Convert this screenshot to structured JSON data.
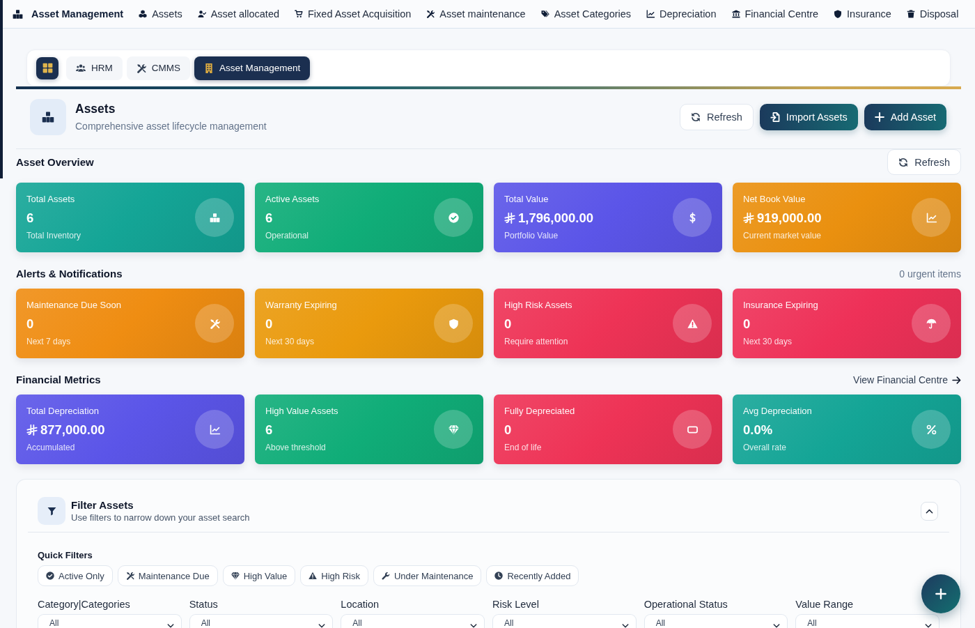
{
  "top_nav": {
    "brand": "Asset Management",
    "items": [
      "Assets",
      "Asset allocated",
      "Fixed Asset Acquisition",
      "Asset maintenance",
      "Asset Categories",
      "Depreciation",
      "Financial Centre",
      "Insurance",
      "Disposal"
    ]
  },
  "module_tabs": [
    {
      "label": "HRM",
      "selected": false
    },
    {
      "label": "CMMS",
      "selected": false
    },
    {
      "label": "Asset Management",
      "selected": true
    }
  ],
  "page_header": {
    "title": "Assets",
    "subtitle": "Comprehensive asset lifecycle management",
    "buttons": [
      {
        "label": "Refresh",
        "kind": "outline"
      },
      {
        "label": "Import Assets",
        "kind": "primary"
      },
      {
        "label": "Add Asset",
        "kind": "primary"
      }
    ]
  },
  "sections": [
    {
      "title": "Asset Overview",
      "aside": {
        "kind": "button",
        "label": "Refresh"
      },
      "cards": [
        {
          "label": "Total Assets",
          "value": "6",
          "note": "Total Inventory",
          "currency": false,
          "color": "#14a596"
        },
        {
          "label": "Active Assets",
          "value": "6",
          "note": "Operational",
          "currency": false,
          "color": "#10ad78"
        },
        {
          "label": "Total Value",
          "value": "1,796,000.00",
          "note": "Portfolio Value",
          "currency": true,
          "color": "#5b55e8"
        },
        {
          "label": "Net Book Value",
          "value": "919,000.00",
          "note": "Current market value",
          "currency": true,
          "color": "#ea900f"
        }
      ]
    },
    {
      "title": "Alerts & Notifications",
      "aside": {
        "kind": "note",
        "label": "0 urgent items"
      },
      "cards": [
        {
          "label": "Maintenance Due Soon",
          "value": "0",
          "note": "Next 7 days",
          "currency": false,
          "color": "#ef8d12"
        },
        {
          "label": "Warranty Expiring",
          "value": "0",
          "note": "Next 30 days",
          "currency": false,
          "color": "#ea9a0d"
        },
        {
          "label": "High Risk Assets",
          "value": "0",
          "note": "Require attention",
          "currency": false,
          "color": "#ee3356"
        },
        {
          "label": "Insurance Expiring",
          "value": "0",
          "note": "Next 30 days",
          "currency": false,
          "color": "#ee3158"
        }
      ]
    },
    {
      "title": "Financial Metrics",
      "aside": {
        "kind": "link",
        "label": "View Financial Centre"
      },
      "cards": [
        {
          "label": "Total Depreciation",
          "value": "877,000.00",
          "note": "Accumulated",
          "currency": true,
          "color": "#5b55e8"
        },
        {
          "label": "High Value Assets",
          "value": "6",
          "note": "Above threshold",
          "currency": false,
          "color": "#10ad78"
        },
        {
          "label": "Fully Depreciated",
          "value": "0",
          "note": "End of life",
          "currency": false,
          "color": "#ee3356"
        },
        {
          "label": "Avg Depreciation",
          "value": "0.0%",
          "note": "Overall rate",
          "currency": false,
          "color": "#14a596"
        }
      ]
    }
  ],
  "filters": {
    "title": "Filter Assets",
    "subtitle": "Use filters to narrow down your asset search",
    "expanded": true,
    "quick_filters_title": "Quick Filters",
    "quick_filters": [
      "Active Only",
      "Maintenance Due",
      "High Value",
      "High Risk",
      "Under Maintenance",
      "Recently Added"
    ],
    "fields": [
      {
        "label": "Category|Categories",
        "value": "All"
      },
      {
        "label": "Status",
        "value": "All"
      },
      {
        "label": "Location",
        "value": "All"
      },
      {
        "label": "Risk Level",
        "value": "All"
      },
      {
        "label": "Operational Status",
        "value": "All"
      },
      {
        "label": "Value Range",
        "value": "All"
      }
    ]
  }
}
